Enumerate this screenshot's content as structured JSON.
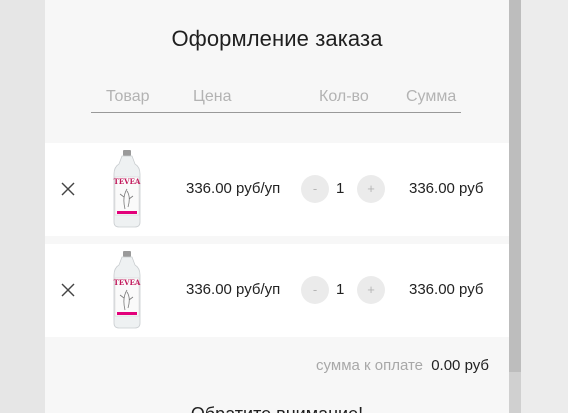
{
  "order": {
    "title": "Оформление заказа",
    "columns": {
      "product": "Товар",
      "price": "Цена",
      "qty": "Кол-во",
      "sum": "Сумма"
    },
    "items": [
      {
        "price": "336.00 руб/уп",
        "minus": "-",
        "qty": "1",
        "plus": "+",
        "sum": "336.00 руб",
        "product_label": "TEVEA"
      },
      {
        "price": "336.00 руб/уп",
        "minus": "-",
        "qty": "1",
        "plus": "+",
        "sum": "336.00 руб",
        "product_label": "TEVEA"
      }
    ],
    "total": {
      "label": "сумма к оплате",
      "value": "0.00 руб"
    },
    "notice": "Обратите внимание!"
  },
  "colors": {
    "accent": "#d94a8c",
    "background": "#f7f7f7",
    "row": "#ffffff"
  },
  "icons": [
    "close-icon",
    "remove-item-icon",
    "minus-icon",
    "plus-icon"
  ]
}
